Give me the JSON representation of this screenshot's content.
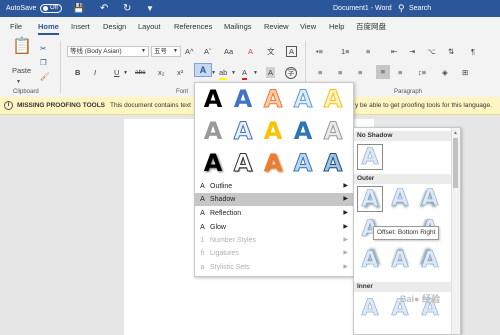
{
  "titlebar": {
    "autosave_label": "AutoSave",
    "autosave_state": "Off",
    "doc_title": "Document1 - Word",
    "search_label": "Search"
  },
  "tabs": [
    "File",
    "Home",
    "Insert",
    "Design",
    "Layout",
    "References",
    "Mailings",
    "Review",
    "View",
    "Help",
    "百度网盘"
  ],
  "active_tab": "Home",
  "ribbon": {
    "paste_label": "Paste",
    "font_name": "等线 (Body Asian)",
    "font_size": "五号",
    "clipboard_label": "Clipboard",
    "font_label": "Font",
    "paragraph_label": "Paragraph",
    "bold": "B",
    "italic": "I",
    "underline": "U",
    "strike": "abc",
    "subscript": "x₂",
    "superscript": "x²",
    "grow_font": "A^",
    "shrink_font": "Aˇ",
    "change_case": "Aa",
    "clear_format": "A",
    "phonetic": "文",
    "char_border": "A",
    "text_effects": "A",
    "highlight": "ab",
    "font_color": "A",
    "char_shading": "A",
    "enclose": "字"
  },
  "message": {
    "title": "MISSING PROOFING TOOLS",
    "text": "This document contains text",
    "text_end": "y be able to get proofing tools for this language."
  },
  "gallery": {
    "letter": "A",
    "menu": [
      {
        "icon": "outline-icon",
        "label": "Outline",
        "enabled": true,
        "highlighted": false
      },
      {
        "icon": "shadow-icon",
        "label": "Shadow",
        "enabled": true,
        "highlighted": true
      },
      {
        "icon": "reflection-icon",
        "label": "Reflection",
        "enabled": true,
        "highlighted": false
      },
      {
        "icon": "glow-icon",
        "label": "Glow",
        "enabled": true,
        "highlighted": false
      },
      {
        "icon": "number-styles-icon",
        "label": "Number Styles",
        "enabled": false,
        "highlighted": false
      },
      {
        "icon": "ligatures-icon",
        "label": "Ligatures",
        "enabled": false,
        "highlighted": false
      },
      {
        "icon": "stylistic-sets-icon",
        "label": "Stylistic Sets",
        "enabled": false,
        "highlighted": false
      }
    ]
  },
  "shadow_menu": {
    "sections": [
      "No Shadow",
      "Outer",
      "Inner"
    ],
    "letter": "A",
    "tooltip": "Offset: Bottom Right"
  },
  "watermark": "百度经验",
  "colors": {
    "accent": "#2b579a",
    "message_bg": "#fdf6c3",
    "menu_highlight": "#c6c6c6"
  }
}
